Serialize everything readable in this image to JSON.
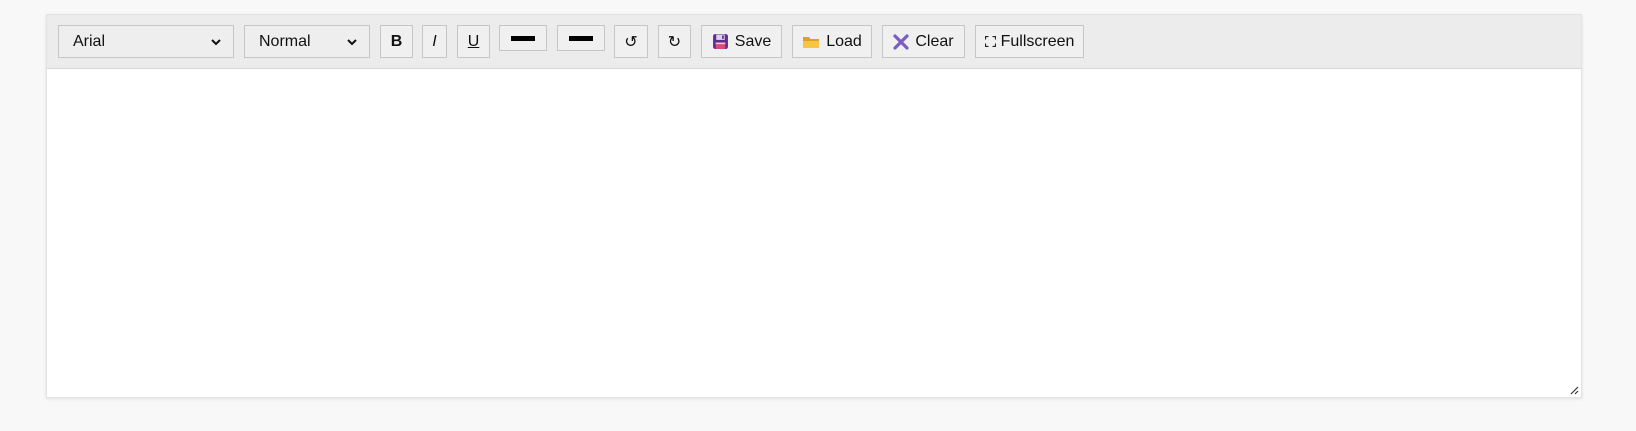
{
  "toolbar": {
    "font_family": {
      "selected": "Arial"
    },
    "font_size": {
      "selected": "Normal"
    },
    "bold_label": "B",
    "italic_label": "I",
    "underline_label": "U",
    "text_color": "#000000",
    "highlight_color": "#000000",
    "undo_icon": "↺",
    "redo_icon": "↻",
    "save": {
      "label": "Save",
      "icon": "floppy-disk-icon"
    },
    "load": {
      "label": "Load",
      "icon": "folder-icon"
    },
    "clear": {
      "label": "Clear",
      "icon": "x-icon"
    },
    "fullscreen": {
      "label": "Fullscreen",
      "icon": "expand-icon"
    }
  },
  "content": {
    "text": ""
  },
  "colors": {
    "page_bg": "#f8f8f8",
    "toolbar_bg": "#ececec",
    "clear_x": "#7b5cc4",
    "folder": "#f3b82c"
  }
}
